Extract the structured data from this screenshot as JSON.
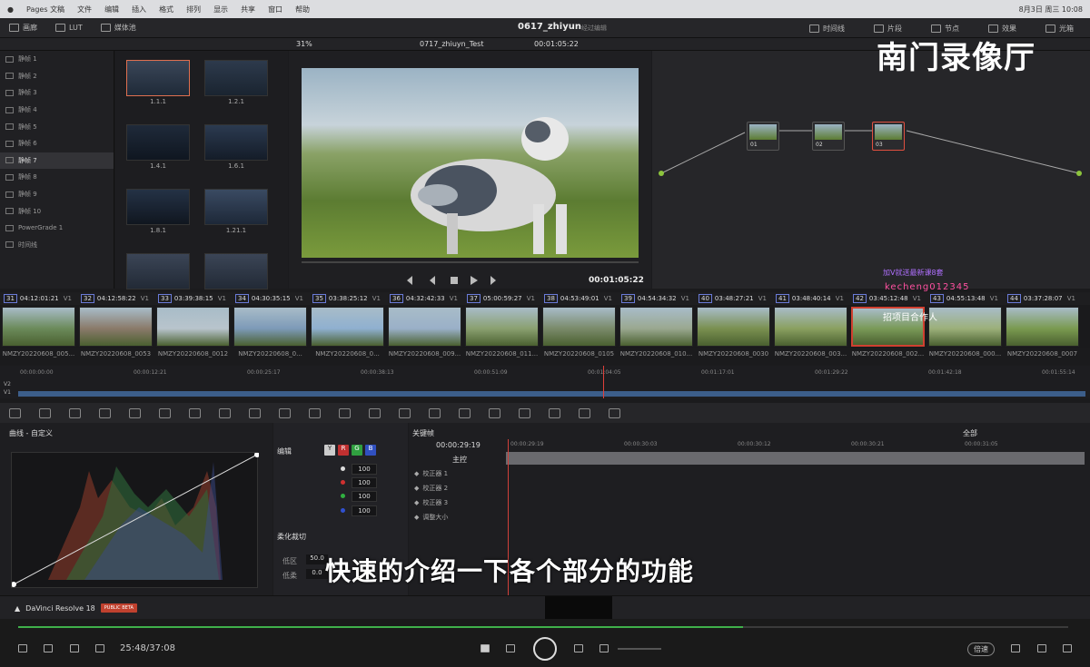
{
  "menubar": {
    "app": "Pages 文稿",
    "items": [
      "文件",
      "编辑",
      "插入",
      "格式",
      "排列",
      "显示",
      "共享",
      "窗口",
      "帮助"
    ],
    "clock": "8月3日 周三 10:08"
  },
  "toolbar": {
    "left": [
      "画廊",
      "LUT",
      "媒体池"
    ],
    "project_title": "0617_zhiyun",
    "project_sub": "经过编辑",
    "right": [
      "时间线",
      "片段",
      "节点",
      "效果",
      "光箱"
    ]
  },
  "viewer": {
    "zoom": "31%",
    "timeline_name": "0717_zhiuyn_Test",
    "header_tc": "00:01:05:22",
    "timecode": "00:01:05:22"
  },
  "gallery": {
    "items": [
      "静帧 1",
      "静帧 2",
      "静帧 3",
      "静帧 4",
      "静帧 5",
      "静帧 6",
      "静帧 7",
      "静帧 8",
      "静帧 9",
      "静帧 10",
      "PowerGrade 1",
      "时间线"
    ],
    "selected_index": 6
  },
  "stills": [
    "1.1.1",
    "1.2.1",
    "1.4.1",
    "1.6.1",
    "1.8.1",
    "1.21.1"
  ],
  "nodes": [
    "01",
    "02",
    "03"
  ],
  "watermark": {
    "main": "南门录像厅",
    "line1": "加V就送最新课8套",
    "line2": "kecheng012345",
    "overlay": "招项目合作人"
  },
  "clips": [
    {
      "num": "31",
      "tc": "04:12:01:21",
      "track": "V1",
      "name": "NMZY20220608_005..."
    },
    {
      "num": "32",
      "tc": "04:12:58:22",
      "track": "V1",
      "name": "NMZY20220608_0053"
    },
    {
      "num": "33",
      "tc": "03:39:38:15",
      "track": "V1",
      "name": "NMZY20220608_0012"
    },
    {
      "num": "34",
      "tc": "04:30:35:15",
      "track": "V1",
      "name": "NMZY20220608_0..."
    },
    {
      "num": "35",
      "tc": "03:38:25:12",
      "track": "V1",
      "name": "NMZY20220608_0..."
    },
    {
      "num": "36",
      "tc": "04:32:42:33",
      "track": "V1",
      "name": "NMZY20220608_009..."
    },
    {
      "num": "37",
      "tc": "05:00:59:27",
      "track": "V1",
      "name": "NMZY20220608_011..."
    },
    {
      "num": "38",
      "tc": "04:53:49:01",
      "track": "V1",
      "name": "NMZY20220608_0105"
    },
    {
      "num": "39",
      "tc": "04:54:34:32",
      "track": "V1",
      "name": "NMZY20220608_010..."
    },
    {
      "num": "40",
      "tc": "03:48:27:21",
      "track": "V1",
      "name": "NMZY20220608_0030"
    },
    {
      "num": "41",
      "tc": "03:48:40:14",
      "track": "V1",
      "name": "NMZY20220608_003..."
    },
    {
      "num": "42",
      "tc": "03:45:12:48",
      "track": "V1",
      "name": "NMZY20220608_002..."
    },
    {
      "num": "43",
      "tc": "04:55:13:48",
      "track": "V1",
      "name": "NMZY20220608_000..."
    },
    {
      "num": "44",
      "tc": "03:37:28:07",
      "track": "V1",
      "name": "NMZY20220608_0007"
    }
  ],
  "timeline": {
    "ticks": [
      "00:00:00:00",
      "00:00:12:21",
      "00:00:25:17",
      "00:00:38:13",
      "00:00:51:09",
      "00:01:04:05",
      "00:01:17:01",
      "00:01:29:22",
      "00:01:42:18",
      "00:01:55:14"
    ],
    "tracks": [
      "V2",
      "V1"
    ]
  },
  "curves": {
    "title": "曲线 - 自定义"
  },
  "edit": {
    "title": "编辑",
    "y_label": "Y",
    "r_label": "R",
    "g_label": "G",
    "b_label": "B",
    "values": [
      "100",
      "100",
      "100",
      "100"
    ],
    "soft_title": "柔化裁切",
    "low_label": "低区",
    "low_val": "50.0",
    "soft_label": "低柔",
    "soft_val": "0.0"
  },
  "keyframes": {
    "title": "关键帧",
    "filter": "全部",
    "current_tc": "00:00:29:19",
    "master": "主控",
    "ticks": [
      "00:00:29:19",
      "00:00:30:03",
      "00:00:30:12",
      "00:00:30:21",
      "00:00:31:05"
    ],
    "rows": [
      "校正器 1",
      "校正器 2",
      "校正器 3",
      "调整大小"
    ]
  },
  "subtitle": "快速的介绍一下各个部分的功能",
  "pagebar": {
    "brand": "DaVinci Resolve 18",
    "beta": "PUBLIC BETA"
  },
  "player": {
    "time": "25:48/37:08",
    "speed": "倍速",
    "progress": 0.69
  },
  "colors": {
    "accent": "#3fb04a",
    "playhead": "#e0403a",
    "selected": "#e07050"
  }
}
